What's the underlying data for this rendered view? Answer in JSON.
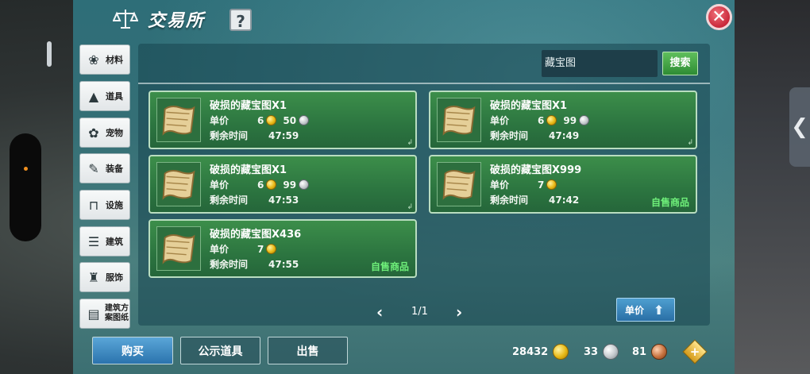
{
  "window": {
    "title": "交易所",
    "help_label": "?",
    "close_label": "✕"
  },
  "sidebar": {
    "items": [
      {
        "label": "材料",
        "icon": "materials-icon"
      },
      {
        "label": "道具",
        "icon": "item-icon"
      },
      {
        "label": "宠物",
        "icon": "pet-paw-icon"
      },
      {
        "label": "装备",
        "icon": "equipment-icon"
      },
      {
        "label": "设施",
        "icon": "facility-icon"
      },
      {
        "label": "建筑",
        "icon": "building-icon"
      },
      {
        "label": "服饰",
        "icon": "clothing-icon"
      },
      {
        "label": "建筑方案图纸",
        "icon": "blueprint-icon",
        "line1": "建筑方",
        "line2": "案图纸"
      }
    ]
  },
  "search": {
    "value": "藏宝图",
    "button_label": "搜索"
  },
  "listing_labels": {
    "price": "单价",
    "time_left": "剩余时间"
  },
  "listings": [
    {
      "name": "破损的藏宝图X1",
      "gold": "6",
      "silver": "50",
      "time": "47:59",
      "self_sale": ""
    },
    {
      "name": "破损的藏宝图X1",
      "gold": "6",
      "silver": "99",
      "time": "47:49",
      "self_sale": ""
    },
    {
      "name": "破损的藏宝图X1",
      "gold": "6",
      "silver": "99",
      "time": "47:53",
      "self_sale": ""
    },
    {
      "name": "破损的藏宝图X999",
      "gold": "7",
      "silver": "",
      "time": "47:42",
      "self_sale": "自售商品"
    },
    {
      "name": "破损的藏宝图X436",
      "gold": "7",
      "silver": "",
      "time": "47:55",
      "self_sale": "自售商品"
    }
  ],
  "pagination": {
    "prev": "‹",
    "page_text": "1/1",
    "next": "›"
  },
  "sort_button": {
    "label": "单价"
  },
  "bottom_tabs": {
    "buy": "购买",
    "public": "公示道具",
    "sell": "出售"
  },
  "currency": {
    "gold": "28432",
    "silver": "33",
    "copper": "81",
    "add_label": "+"
  },
  "colors": {
    "accent_green": "#2e8c34",
    "self_sale_text": "#6ff07a",
    "tab_blue": "#2b73ad"
  }
}
